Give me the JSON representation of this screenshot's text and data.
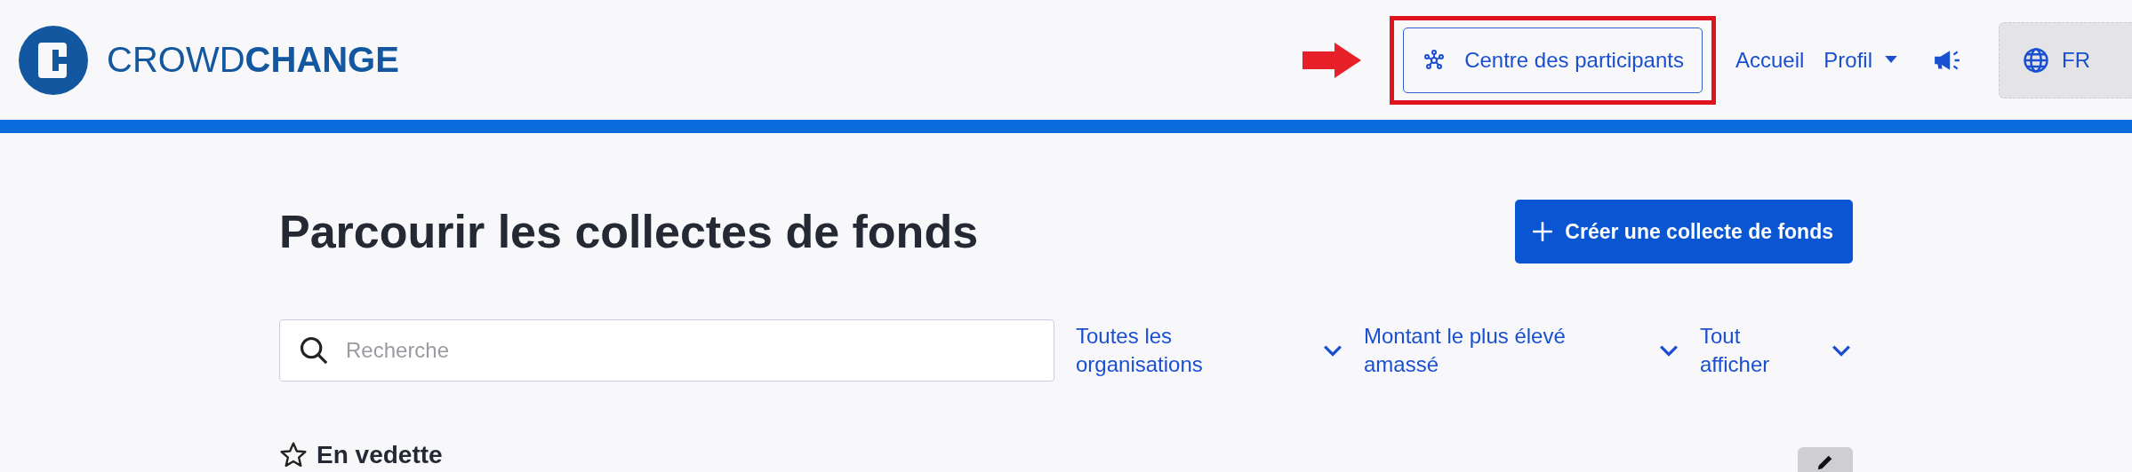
{
  "header": {
    "logo": {
      "light": "CROWD",
      "bold": "CHANGE"
    },
    "participant_center": "Centre des participants",
    "nav": [
      {
        "label": "Accueil",
        "kind": "link"
      },
      {
        "label": "Profil",
        "kind": "dropdown"
      },
      {
        "kind": "announce"
      }
    ],
    "language": "FR"
  },
  "page": {
    "title": "Parcourir les collectes de fonds",
    "create_button": "Créer une collecte de fonds",
    "search": {
      "placeholder": "Recherche"
    },
    "filters": [
      {
        "label": "Toutes les organisations"
      },
      {
        "label": "Montant le plus élevé amassé"
      },
      {
        "label": "Tout afficher"
      }
    ],
    "featured": "En vedette"
  }
}
